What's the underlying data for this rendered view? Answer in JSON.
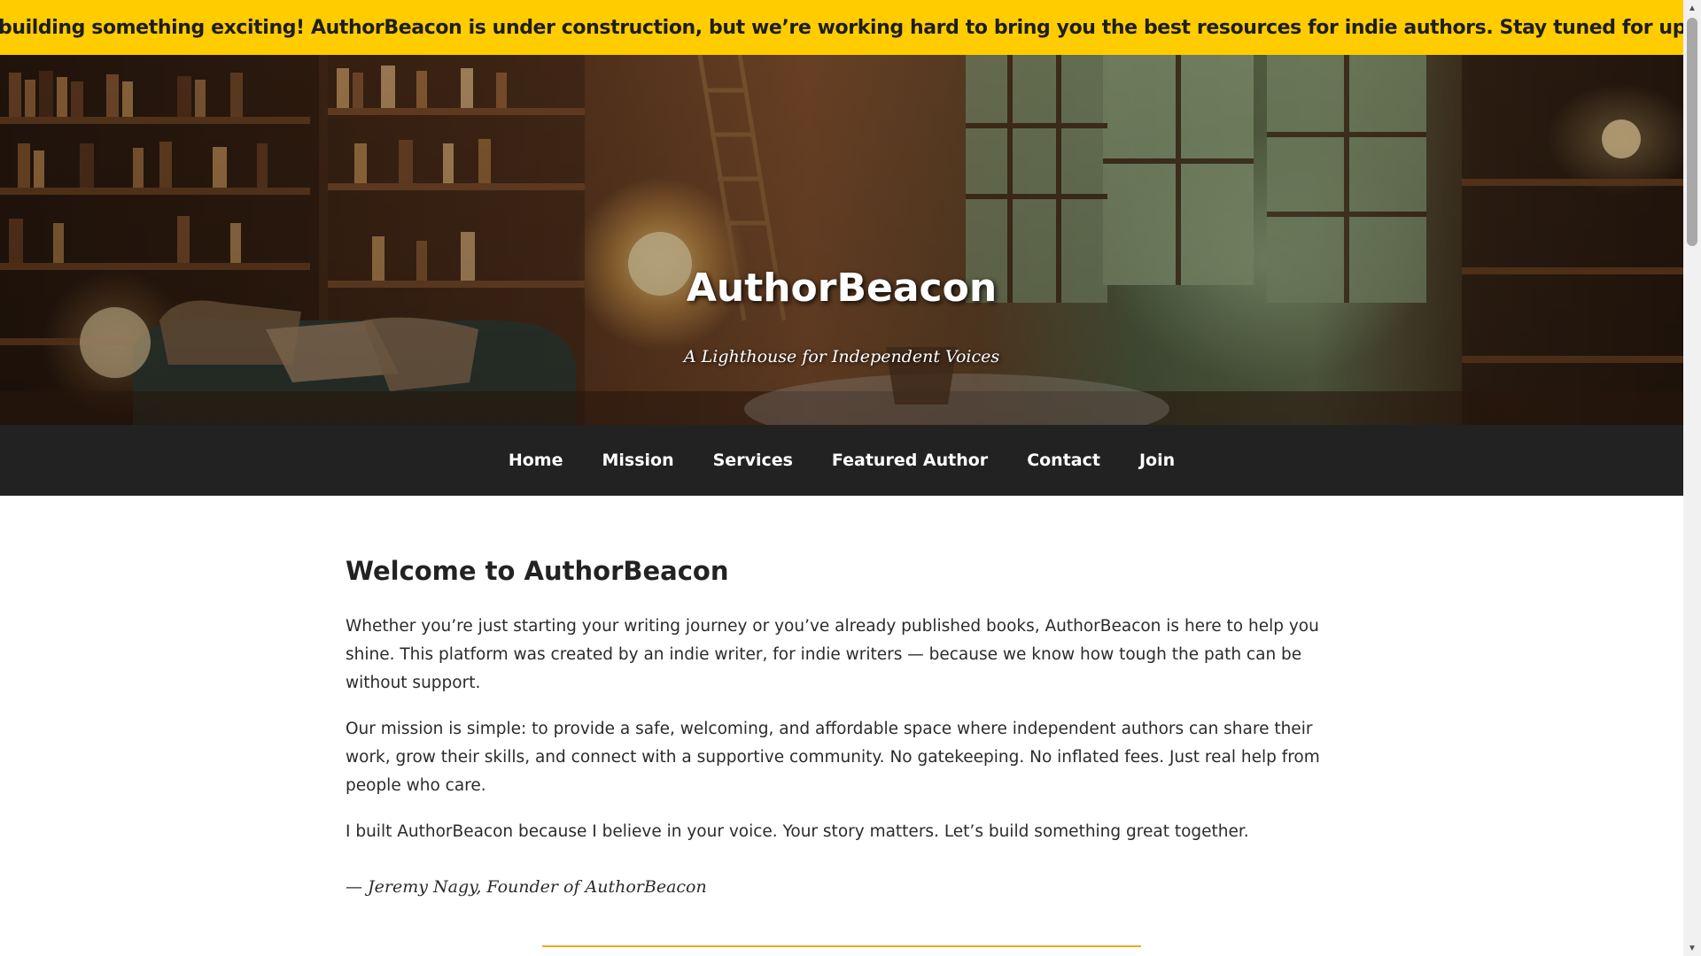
{
  "banner": {
    "text": "We’re building something exciting! AuthorBeacon is under construction, but we’re working hard to bring you the best resources for indie authors. Stay tuned for updates!"
  },
  "hero": {
    "title": "AuthorBeacon",
    "tagline": "A Lighthouse for Independent Voices"
  },
  "nav": {
    "items": [
      {
        "label": "Home"
      },
      {
        "label": "Mission"
      },
      {
        "label": "Services"
      },
      {
        "label": "Featured Author"
      },
      {
        "label": "Contact"
      },
      {
        "label": "Join"
      }
    ]
  },
  "main": {
    "heading": "Welcome to AuthorBeacon",
    "paragraphs": [
      "Whether you’re just starting your writing journey or you’ve already published books, AuthorBeacon is here to help you shine. This platform was created by an indie writer, for indie writers — because we know how tough the path can be without support.",
      "Our mission is simple: to provide a safe, welcoming, and affordable space where independent authors can share their work, grow their skills, and connect with a supportive community. No gatekeeping. No inflated fees. Just real help from people who care.",
      "I built AuthorBeacon because I believe in your voice. Your story matters. Let’s build something great together."
    ],
    "signature": "— Jeremy Nagy, Founder of AuthorBeacon"
  },
  "colors": {
    "banner_bg": "#ffcc00",
    "nav_bg": "#222222",
    "divider": "#f0a818"
  }
}
